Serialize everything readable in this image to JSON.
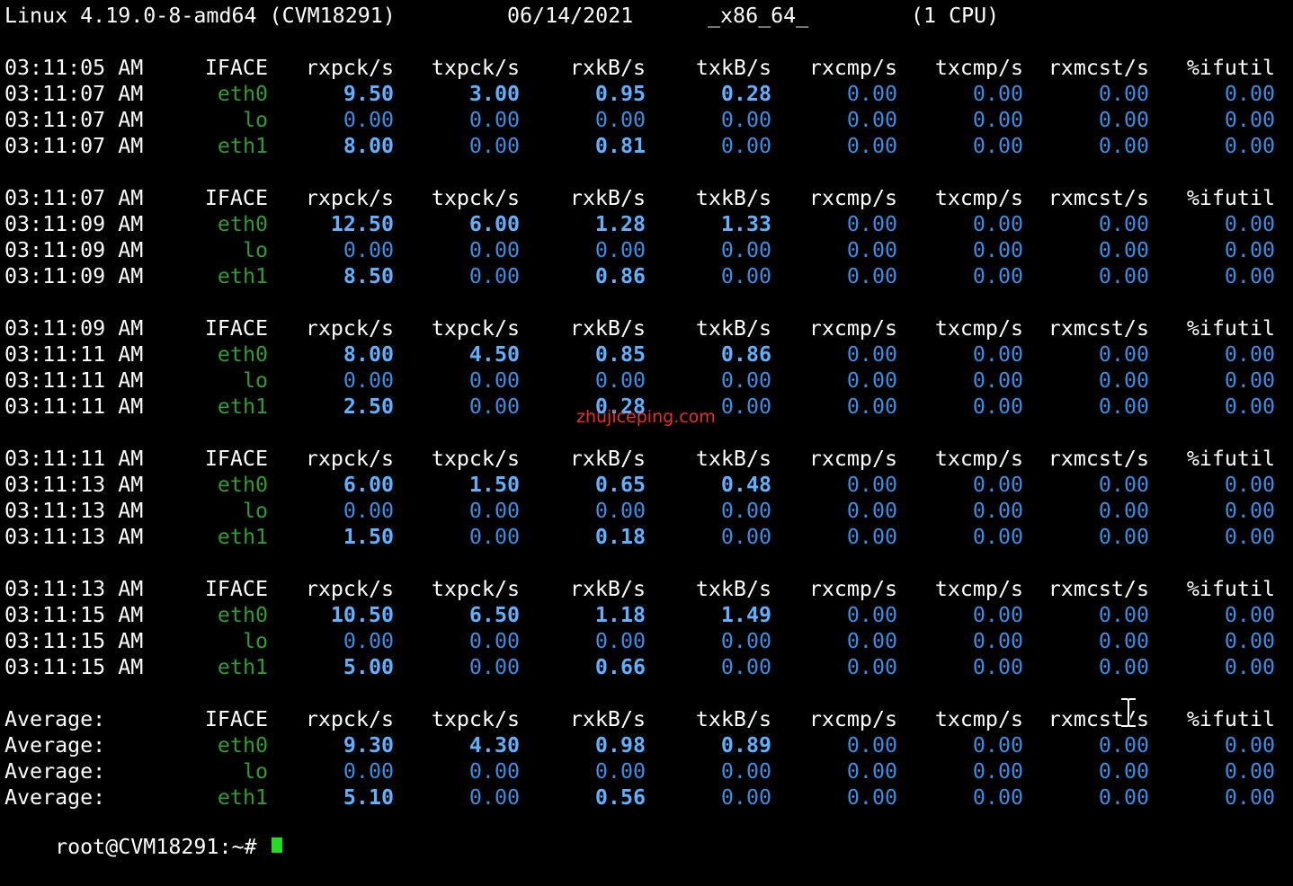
{
  "system": {
    "os": "Linux 4.19.0-8-amd64 (CVM18291)",
    "date": "06/14/2021",
    "arch": "_x86_64_",
    "cpu": "(1 CPU)"
  },
  "columns": [
    "IFACE",
    "rxpck/s",
    "txpck/s",
    "rxkB/s",
    "txkB/s",
    "rxcmp/s",
    "txcmp/s",
    "rxmcst/s",
    "%ifutil"
  ],
  "blocks": [
    {
      "header_time": "03:11:05 AM",
      "rows": [
        {
          "time": "03:11:07 AM",
          "iface": "eth0",
          "v": [
            "9.50",
            "3.00",
            "0.95",
            "0.28",
            "0.00",
            "0.00",
            "0.00",
            "0.00"
          ]
        },
        {
          "time": "03:11:07 AM",
          "iface": "lo",
          "v": [
            "0.00",
            "0.00",
            "0.00",
            "0.00",
            "0.00",
            "0.00",
            "0.00",
            "0.00"
          ]
        },
        {
          "time": "03:11:07 AM",
          "iface": "eth1",
          "v": [
            "8.00",
            "0.00",
            "0.81",
            "0.00",
            "0.00",
            "0.00",
            "0.00",
            "0.00"
          ]
        }
      ]
    },
    {
      "header_time": "03:11:07 AM",
      "rows": [
        {
          "time": "03:11:09 AM",
          "iface": "eth0",
          "v": [
            "12.50",
            "6.00",
            "1.28",
            "1.33",
            "0.00",
            "0.00",
            "0.00",
            "0.00"
          ]
        },
        {
          "time": "03:11:09 AM",
          "iface": "lo",
          "v": [
            "0.00",
            "0.00",
            "0.00",
            "0.00",
            "0.00",
            "0.00",
            "0.00",
            "0.00"
          ]
        },
        {
          "time": "03:11:09 AM",
          "iface": "eth1",
          "v": [
            "8.50",
            "0.00",
            "0.86",
            "0.00",
            "0.00",
            "0.00",
            "0.00",
            "0.00"
          ]
        }
      ]
    },
    {
      "header_time": "03:11:09 AM",
      "rows": [
        {
          "time": "03:11:11 AM",
          "iface": "eth0",
          "v": [
            "8.00",
            "4.50",
            "0.85",
            "0.86",
            "0.00",
            "0.00",
            "0.00",
            "0.00"
          ]
        },
        {
          "time": "03:11:11 AM",
          "iface": "lo",
          "v": [
            "0.00",
            "0.00",
            "0.00",
            "0.00",
            "0.00",
            "0.00",
            "0.00",
            "0.00"
          ]
        },
        {
          "time": "03:11:11 AM",
          "iface": "eth1",
          "v": [
            "2.50",
            "0.00",
            "0.28",
            "0.00",
            "0.00",
            "0.00",
            "0.00",
            "0.00"
          ]
        }
      ]
    },
    {
      "header_time": "03:11:11 AM",
      "rows": [
        {
          "time": "03:11:13 AM",
          "iface": "eth0",
          "v": [
            "6.00",
            "1.50",
            "0.65",
            "0.48",
            "0.00",
            "0.00",
            "0.00",
            "0.00"
          ]
        },
        {
          "time": "03:11:13 AM",
          "iface": "lo",
          "v": [
            "0.00",
            "0.00",
            "0.00",
            "0.00",
            "0.00",
            "0.00",
            "0.00",
            "0.00"
          ]
        },
        {
          "time": "03:11:13 AM",
          "iface": "eth1",
          "v": [
            "1.50",
            "0.00",
            "0.18",
            "0.00",
            "0.00",
            "0.00",
            "0.00",
            "0.00"
          ]
        }
      ]
    },
    {
      "header_time": "03:11:13 AM",
      "rows": [
        {
          "time": "03:11:15 AM",
          "iface": "eth0",
          "v": [
            "10.50",
            "6.50",
            "1.18",
            "1.49",
            "0.00",
            "0.00",
            "0.00",
            "0.00"
          ]
        },
        {
          "time": "03:11:15 AM",
          "iface": "lo",
          "v": [
            "0.00",
            "0.00",
            "0.00",
            "0.00",
            "0.00",
            "0.00",
            "0.00",
            "0.00"
          ]
        },
        {
          "time": "03:11:15 AM",
          "iface": "eth1",
          "v": [
            "5.00",
            "0.00",
            "0.66",
            "0.00",
            "0.00",
            "0.00",
            "0.00",
            "0.00"
          ]
        }
      ]
    },
    {
      "header_time": "Average:",
      "rows": [
        {
          "time": "Average:",
          "iface": "eth0",
          "v": [
            "9.30",
            "4.30",
            "0.98",
            "0.89",
            "0.00",
            "0.00",
            "0.00",
            "0.00"
          ]
        },
        {
          "time": "Average:",
          "iface": "lo",
          "v": [
            "0.00",
            "0.00",
            "0.00",
            "0.00",
            "0.00",
            "0.00",
            "0.00",
            "0.00"
          ]
        },
        {
          "time": "Average:",
          "iface": "eth1",
          "v": [
            "5.10",
            "0.00",
            "0.56",
            "0.00",
            "0.00",
            "0.00",
            "0.00",
            "0.00"
          ]
        }
      ]
    }
  ],
  "watermark": "zhujiceping.com",
  "prompt": "root@CVM18291:~#",
  "colors": {
    "background": "#000000",
    "text": "#ffffff",
    "iface": "#2e9e2e",
    "value": "#3a8ee6",
    "value_bold": "#5fb0ff",
    "watermark": "#e8302a",
    "cursor": "#22dd22"
  }
}
